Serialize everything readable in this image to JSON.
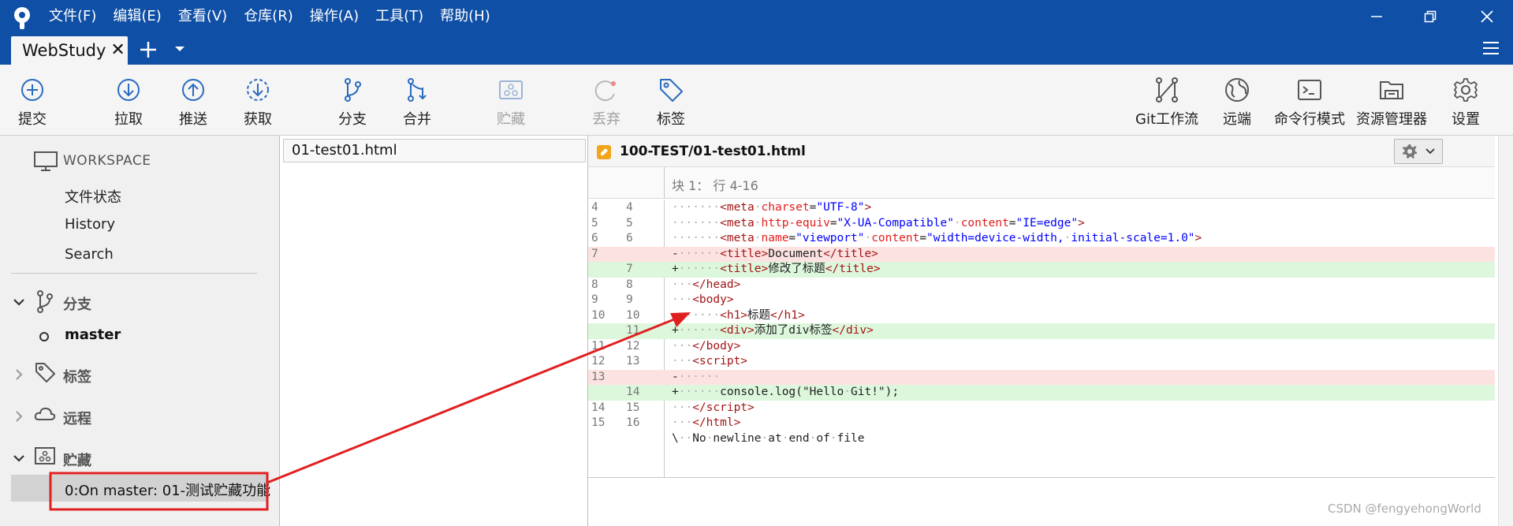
{
  "menu": [
    "文件(F)",
    "编辑(E)",
    "查看(V)",
    "仓库(R)",
    "操作(A)",
    "工具(T)",
    "帮助(H)"
  ],
  "tab": {
    "name": "WebStudy",
    "close": "✕"
  },
  "toolbar": [
    {
      "label": "提交",
      "icon": "commit-icon"
    },
    {
      "label": "拉取",
      "icon": "pull-icon"
    },
    {
      "label": "推送",
      "icon": "push-icon"
    },
    {
      "label": "获取",
      "icon": "fetch-icon"
    },
    {
      "label": "分支",
      "icon": "branch-icon"
    },
    {
      "label": "合并",
      "icon": "merge-icon"
    },
    {
      "label": "贮藏",
      "icon": "stash-icon",
      "disabled": true
    },
    {
      "label": "丢弃",
      "icon": "discard-icon",
      "disabled": true
    },
    {
      "label": "标签",
      "icon": "tag-icon"
    },
    {
      "label": "Git工作流",
      "icon": "git-flow-icon"
    },
    {
      "label": "远端",
      "icon": "globe-icon"
    },
    {
      "label": "命令行模式",
      "icon": "terminal-icon"
    },
    {
      "label": "资源管理器",
      "icon": "folder-icon"
    },
    {
      "label": "设置",
      "icon": "gear-icon"
    }
  ],
  "sidebar": {
    "workspace": "WORKSPACE",
    "items": [
      "文件状态",
      "History",
      "Search"
    ],
    "branches": {
      "title": "分支",
      "current": "master"
    },
    "tags": {
      "title": "标签"
    },
    "remotes": {
      "title": "远程"
    },
    "stashes": {
      "title": "贮藏",
      "entry": "0:On master: 01-测试贮藏功能"
    }
  },
  "files": [
    "01-test01.html"
  ],
  "diff": {
    "path": "100-TEST/01-test01.html",
    "hunk": "块 1： 行 4-16"
  },
  "watermark": "CSDN @fengyehongWorld",
  "colors": {
    "titlebar": "#0f4fa5",
    "added": "#dcf7dc",
    "removed": "#fde2e2",
    "annotation": "#e02020"
  }
}
